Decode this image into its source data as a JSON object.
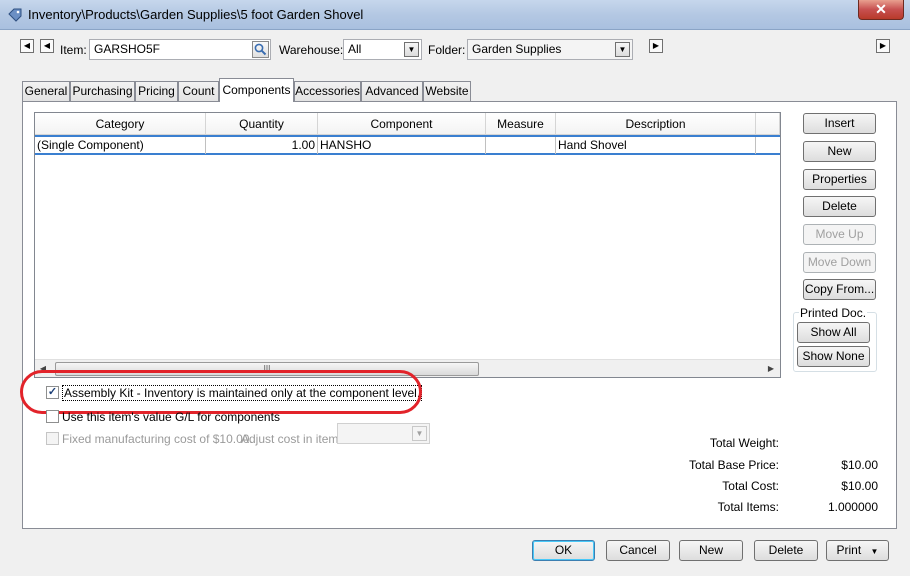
{
  "window": {
    "title": "Inventory\\Products\\Garden Supplies\\5 foot Garden Shovel",
    "close_glyph": "✕"
  },
  "nav": {
    "first": "◀",
    "prev": "◀",
    "next": "▶",
    "last": "▶"
  },
  "item": {
    "label": "Item:",
    "value": "GARSHO5F"
  },
  "warehouse": {
    "label": "Warehouse:",
    "value": "All"
  },
  "folder": {
    "label": "Folder:",
    "value": "Garden Supplies"
  },
  "tabs": [
    "General",
    "Purchasing",
    "Pricing",
    "Count",
    "Components",
    "Accessories",
    "Advanced",
    "Website"
  ],
  "active_tab": "Components",
  "grid": {
    "columns": [
      "Category",
      "Quantity",
      "Component",
      "Measure",
      "Description"
    ],
    "rows": [
      {
        "category": "(Single Component)",
        "quantity": "1.00",
        "component": "HANSHO",
        "measure": "",
        "description": "Hand Shovel"
      }
    ],
    "scroll_thumb_grip": "III"
  },
  "side_buttons": {
    "insert": "Insert",
    "new": "New",
    "properties": "Properties",
    "delete": "Delete",
    "move_up": "Move Up",
    "move_down": "Move Down",
    "copy_from": "Copy From..."
  },
  "printed_doc": {
    "title": "Printed Doc.",
    "show_all": "Show All",
    "show_none": "Show None"
  },
  "options": {
    "assembly_kit": {
      "label": "Assembly Kit - Inventory is maintained only at the component level.",
      "checked": true
    },
    "use_value": {
      "label": "Use this item's value G/L for components",
      "checked": false
    },
    "fixed_cost": {
      "label": "Fixed manufacturing cost of $10.00.",
      "checked": false
    },
    "adjust_cost_label": "Adjust cost in item:"
  },
  "totals": {
    "weight_label": "Total Weight:",
    "weight_value": "",
    "base_price_label": "Total Base Price:",
    "base_price_value": "$10.00",
    "cost_label": "Total Cost:",
    "cost_value": "$10.00",
    "items_label": "Total Items:",
    "items_value": "1.000000"
  },
  "footer": {
    "ok": "OK",
    "cancel": "Cancel",
    "new": "New",
    "delete": "Delete",
    "print": "Print"
  },
  "colors": {
    "highlight_ring": "#e2232a",
    "selection_border": "#3a7fd0",
    "titlebar": "#b4c8e3"
  }
}
